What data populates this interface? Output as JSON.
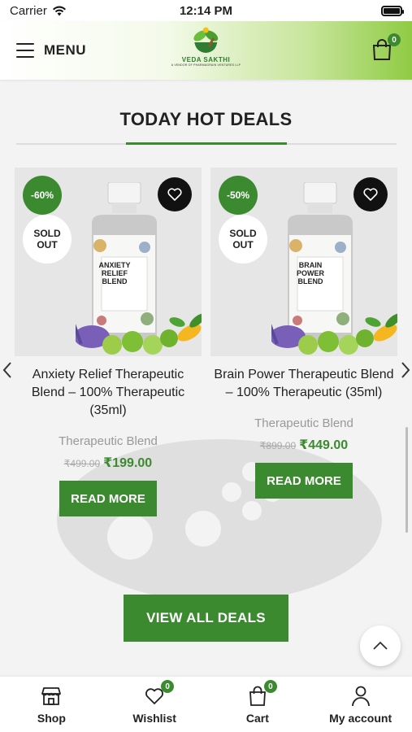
{
  "status_bar": {
    "carrier": "Carrier",
    "time": "12:14 PM"
  },
  "header": {
    "menu_label": "MENU",
    "logo_text": "VEDA SAKTHI",
    "logo_subtext": "A VENDOR OF PHARMAGRAIN VENTURES LLP",
    "cart_count": "0"
  },
  "section": {
    "title": "TODAY HOT DEALS"
  },
  "products": [
    {
      "discount": "-60%",
      "sold_out": "SOLD OUT",
      "bottle_label": "ANXIETY RELIEF BLEND",
      "name": "Anxiety Relief Therapeutic Blend – 100% Therapeutic (35ml)",
      "category": "Therapeutic Blend",
      "old_price": "₹499.00",
      "new_price": "₹199.00",
      "button": "READ MORE"
    },
    {
      "discount": "-50%",
      "sold_out": "SOLD OUT",
      "bottle_label": "BRAIN POWER BLEND",
      "name": "Brain Power Therapeutic Blend – 100% Therapeutic (35ml)",
      "category": "Therapeutic Blend",
      "old_price": "₹899.00",
      "new_price": "₹449.00",
      "button": "READ MORE"
    }
  ],
  "view_all_label": "VIEW ALL DEALS",
  "bottom_nav": {
    "items": [
      {
        "label": "Shop",
        "icon": "shop-icon"
      },
      {
        "label": "Wishlist",
        "icon": "heart-icon",
        "badge": "0"
      },
      {
        "label": "Cart",
        "icon": "bag-icon",
        "badge": "0"
      },
      {
        "label": "My account",
        "icon": "user-icon"
      }
    ]
  },
  "colors": {
    "accent": "#3c8a30",
    "header_gradient_end": "#8fcb43"
  }
}
